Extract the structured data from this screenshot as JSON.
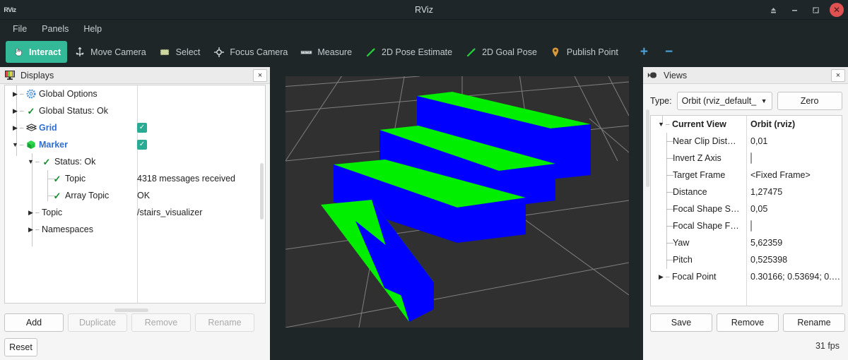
{
  "window": {
    "app_icon_text": "RViz",
    "title": "RViz",
    "controls": {
      "shade_icon": "shade-icon",
      "minimize_icon": "minimize-icon",
      "maximize_icon": "maximize-icon",
      "close_icon": "close-icon",
      "close_glyph": "✕"
    }
  },
  "menubar": {
    "items": [
      {
        "label": "File"
      },
      {
        "label": "Panels"
      },
      {
        "label": "Help"
      }
    ]
  },
  "toolbar": {
    "tools": [
      {
        "label": "Interact",
        "icon": "hand-pointer-icon",
        "active": true
      },
      {
        "label": "Move Camera",
        "icon": "move-camera-icon",
        "active": false
      },
      {
        "label": "Select",
        "icon": "select-rectangle-icon",
        "active": false
      },
      {
        "label": "Focus Camera",
        "icon": "focus-camera-icon",
        "active": false
      },
      {
        "label": "Measure",
        "icon": "ruler-icon",
        "active": false
      },
      {
        "label": "2D Pose Estimate",
        "icon": "pose-arrow-icon",
        "active": false
      },
      {
        "label": "2D Goal Pose",
        "icon": "goal-arrow-icon",
        "active": false
      },
      {
        "label": "Publish Point",
        "icon": "map-pin-icon",
        "active": false
      }
    ],
    "add_tool_label": "+",
    "remove_tool_label": "−",
    "accent_color": "#33b898",
    "plusminus_color": "#4aa3df"
  },
  "displays_panel": {
    "title": "Displays",
    "icon": "monitor-color-bars-icon",
    "close_label": "×",
    "tree": [
      {
        "name": "Global Options",
        "value": "",
        "icon": "gear-icon",
        "expander": "collapsed",
        "indent": 0,
        "style": "normal"
      },
      {
        "name": "Global Status: Ok",
        "value": "",
        "icon": "check-icon",
        "expander": "collapsed",
        "indent": 0,
        "style": "normal"
      },
      {
        "name": "Grid",
        "value": "",
        "icon": "grid-icon",
        "expander": "collapsed",
        "indent": 0,
        "style": "blue-bold",
        "checkbox": "checked"
      },
      {
        "name": "Marker",
        "value": "",
        "icon": "cube-icon",
        "expander": "expanded",
        "indent": 0,
        "style": "blue-bold",
        "checkbox": "checked"
      },
      {
        "name": "Status: Ok",
        "value": "",
        "icon": "check-icon",
        "expander": "expanded",
        "indent": 1,
        "style": "normal"
      },
      {
        "name": "Topic",
        "value": "4318 messages received",
        "icon": "check-icon",
        "expander": "none",
        "indent": 2,
        "style": "normal"
      },
      {
        "name": "Array Topic",
        "value": "OK",
        "icon": "check-icon",
        "expander": "none",
        "indent": 2,
        "style": "normal"
      },
      {
        "name": "Topic",
        "value": "/stairs_visualizer",
        "icon": "none",
        "expander": "collapsed",
        "indent": 1,
        "style": "normal"
      },
      {
        "name": "Namespaces",
        "value": "",
        "icon": "none",
        "expander": "collapsed",
        "indent": 1,
        "style": "normal"
      }
    ],
    "buttons": [
      {
        "label": "Add",
        "enabled": true
      },
      {
        "label": "Duplicate",
        "enabled": false
      },
      {
        "label": "Remove",
        "enabled": false
      },
      {
        "label": "Rename",
        "enabled": false
      }
    ],
    "reset_button": {
      "label": "Reset",
      "enabled": true
    }
  },
  "views_panel": {
    "title": "Views",
    "icon": "camera-icon",
    "close_label": "×",
    "type_label": "Type:",
    "type_value": "Orbit (rviz_default_",
    "zero_button": "Zero",
    "tree": [
      {
        "name": "Current View",
        "value": "Orbit (rviz)",
        "expander": "expanded",
        "indent": 0,
        "style": "bold",
        "control": "text"
      },
      {
        "name": "Near Clip Dist…",
        "value": "0,01",
        "expander": "none",
        "indent": 1,
        "style": "normal",
        "control": "text"
      },
      {
        "name": "Invert Z Axis",
        "value": "",
        "expander": "none",
        "indent": 1,
        "style": "normal",
        "control": "checkbox-empty"
      },
      {
        "name": "Target Frame",
        "value": "<Fixed Frame>",
        "expander": "none",
        "indent": 1,
        "style": "normal",
        "control": "text"
      },
      {
        "name": "Distance",
        "value": "1,27475",
        "expander": "none",
        "indent": 1,
        "style": "normal",
        "control": "text"
      },
      {
        "name": "Focal Shape S…",
        "value": "0,05",
        "expander": "none",
        "indent": 1,
        "style": "normal",
        "control": "text"
      },
      {
        "name": "Focal Shape F…",
        "value": "",
        "expander": "none",
        "indent": 1,
        "style": "normal",
        "control": "checkbox-empty"
      },
      {
        "name": "Yaw",
        "value": "5,62359",
        "expander": "none",
        "indent": 1,
        "style": "normal",
        "control": "text"
      },
      {
        "name": "Pitch",
        "value": "0,525398",
        "expander": "none",
        "indent": 1,
        "style": "normal",
        "control": "text"
      },
      {
        "name": "Focal Point",
        "value": "0.30166; 0.53694; 0.…",
        "expander": "collapsed",
        "indent": 1,
        "style": "normal",
        "control": "text"
      }
    ],
    "buttons": [
      {
        "label": "Save",
        "enabled": true
      },
      {
        "label": "Remove",
        "enabled": true
      },
      {
        "label": "Rename",
        "enabled": true
      }
    ]
  },
  "status_bar": {
    "fps": "31 fps"
  },
  "viewport": {
    "background_color": "#303030",
    "grid_color": "#9a9a9a",
    "marker_top_color": "#00ee00",
    "marker_front_color": "#0000ff",
    "scene_description": "Three green-and-blue stair step markers on a dark grid floor"
  }
}
